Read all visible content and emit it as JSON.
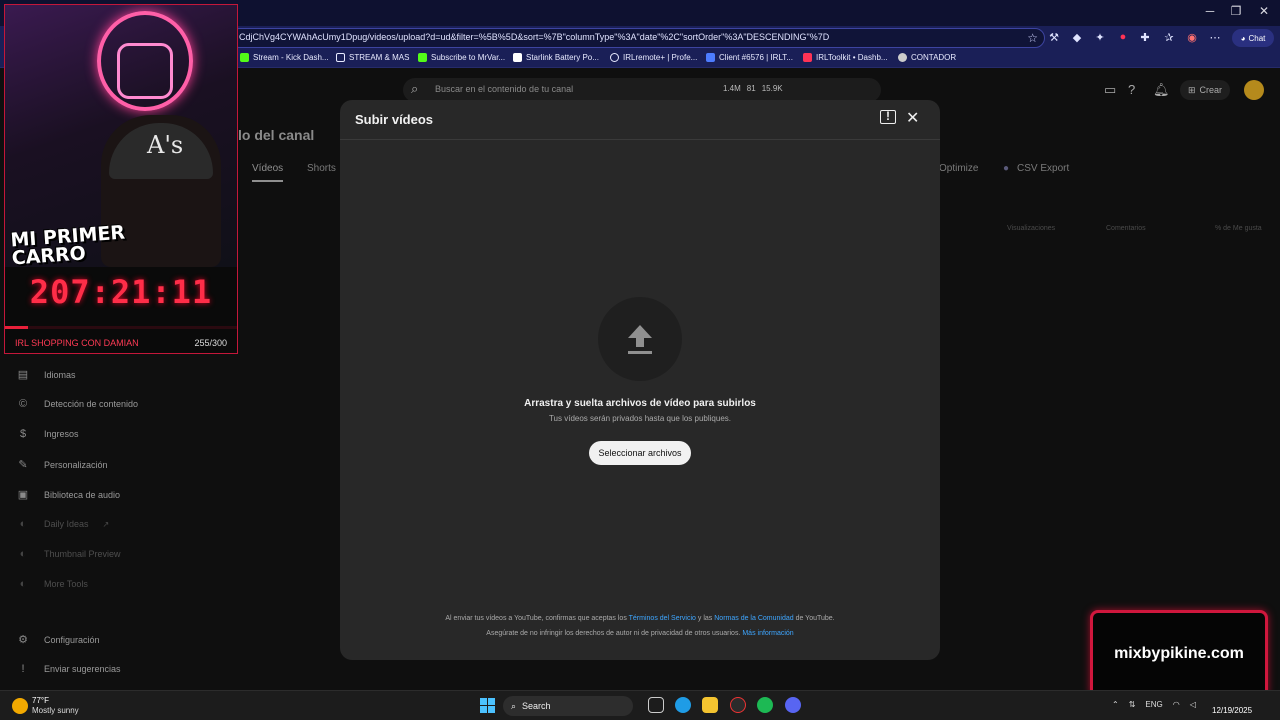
{
  "browser": {
    "url": "CdjChVg4CYWAhAcUmy1Dpug/videos/upload?d=ud&filter=%5B%5D&sort=%7B\"columnType\"%3A\"date\"%2C\"sortOrder\"%3A\"DESCENDING\"%7D",
    "chat_label": "Chat",
    "bookmarks": [
      "Stream - Kick Dash...",
      "STREAM & MAS",
      "Subscribe to MrVar...",
      "Starlink Battery Po...",
      "IRLremote+ | Profe...",
      "Client #6576 | IRLT...",
      "IRLToolkit • Dashb...",
      "CONTADOR"
    ]
  },
  "yt_header": {
    "search_placeholder": "Buscar en el contenido de tu canal",
    "stat_views": "1.4M",
    "stat_mid": "81",
    "stat_subs": "15.9K",
    "create_label": "Crear"
  },
  "background_page": {
    "title": "lo del canal",
    "tabs": [
      "Vídeos",
      "Shorts"
    ],
    "right_tabs": [
      "Optimize",
      "CSV Export"
    ],
    "columns": [
      "Visualizaciones",
      "Comentarios",
      "% de Me gusta"
    ]
  },
  "sidebar": {
    "items": [
      {
        "label": "Idiomas",
        "icon": "subtitles-icon",
        "glyph": "▤"
      },
      {
        "label": "Detección de contenido",
        "icon": "copyright-icon",
        "glyph": "©"
      },
      {
        "label": "Ingresos",
        "icon": "dollar-icon",
        "glyph": "$"
      },
      {
        "label": "Personalización",
        "icon": "magic-wand-icon",
        "glyph": "✎"
      },
      {
        "label": "Biblioteca de audio",
        "icon": "audio-library-icon",
        "glyph": "▣"
      },
      {
        "label": "Daily Ideas",
        "icon": "ideas-icon",
        "glyph": "◐"
      },
      {
        "label": "Thumbnail Preview",
        "icon": "thumbnail-icon",
        "glyph": "◐"
      },
      {
        "label": "More Tools",
        "icon": "tools-icon",
        "glyph": "◐"
      }
    ],
    "settings_label": "Configuración",
    "feedback_label": "Enviar sugerencias"
  },
  "stream_overlay": {
    "sticker_text": "MI PRIMER CARRO",
    "cap_logo": "A's",
    "timer": "207:21:11",
    "goal_label": "IRL SHOPPING CON DAMIAN",
    "goal_count": "255/300",
    "goal_progress": 0.1,
    "neon_color": "#ff5fa8",
    "accent_color": "#ff2d48"
  },
  "modal": {
    "title": "Subir vídeos",
    "drop_title": "Arrastra y suelta archivos de vídeo para subirlos",
    "drop_subtitle": "Tus vídeos serán privados hasta que los publiques.",
    "select_button": "Seleccionar archivos",
    "legal_line1_a": "Al enviar tus vídeos a YouTube, confirmas que aceptas los ",
    "legal_link_terms": "Términos del Servicio",
    "legal_line1_b": " y las ",
    "legal_link_norms": "Normas de la Comunidad",
    "legal_line1_c": " de YouTube.",
    "legal_line2_a": "Asegúrate de no infringir los derechos de autor ni de privacidad de otros usuarios. ",
    "legal_link_more": "Más información"
  },
  "watermark": {
    "text": "mixbypikine.com"
  },
  "taskbar": {
    "weather_temp": "77°F",
    "weather_desc": "Mostly sunny",
    "search_label": "Search",
    "lang": "ENG",
    "date": "12/19/2025"
  }
}
